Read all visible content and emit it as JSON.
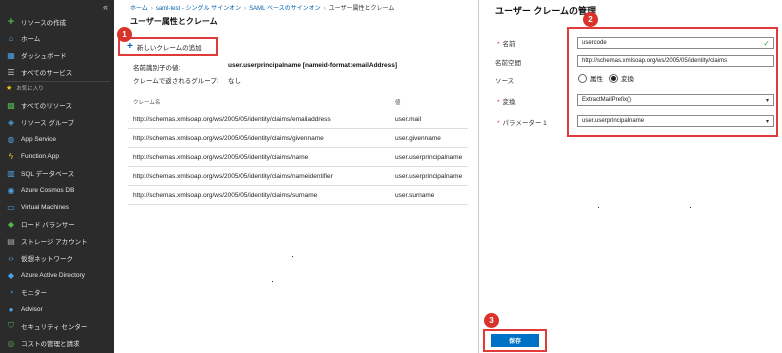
{
  "sidebar": {
    "collapse_icon": "double-chevron-left-icon",
    "items": [
      {
        "label": "リソースの作成",
        "icon": "plus-icon",
        "color": "#4fb34f"
      },
      {
        "label": "ホーム",
        "icon": "home-icon",
        "color": "#4aa3e8"
      },
      {
        "label": "ダッシュボード",
        "icon": "dashboard-icon",
        "color": "#4aa3e8"
      },
      {
        "label": "すべてのサービス",
        "icon": "list-icon",
        "color": "#cccccc"
      },
      {
        "label": "すべてのリソース",
        "icon": "grid-icon",
        "color": "#4fb34f"
      },
      {
        "label": "リソース グループ",
        "icon": "cube-icon",
        "color": "#4aa3e8"
      },
      {
        "label": "App Service",
        "icon": "globe-icon",
        "color": "#4aa3e8"
      },
      {
        "label": "Function App",
        "icon": "lightning-icon",
        "color": "#f2c811"
      },
      {
        "label": "SQL データベース",
        "icon": "database-icon",
        "color": "#4aa3e8"
      },
      {
        "label": "Azure Cosmos DB",
        "icon": "planet-icon",
        "color": "#4aa3e8"
      },
      {
        "label": "Virtual Machines",
        "icon": "monitor-icon",
        "color": "#4aa3e8"
      },
      {
        "label": "ロード バランサー",
        "icon": "diamond-icon",
        "color": "#4fb34f"
      },
      {
        "label": "ストレージ アカウント",
        "icon": "storage-icon",
        "color": "#aaaaaa"
      },
      {
        "label": "仮想ネットワーク",
        "icon": "network-icon",
        "color": "#4aa3e8"
      },
      {
        "label": "Azure Active Directory",
        "icon": "aad-icon",
        "color": "#4aa3e8"
      },
      {
        "label": "モニター",
        "icon": "gauge-icon",
        "color": "#4aa3e8"
      },
      {
        "label": "Advisor",
        "icon": "advisor-icon",
        "color": "#4aa3e8"
      },
      {
        "label": "セキュリティ センター",
        "icon": "shield-icon",
        "color": "#4fb34f"
      },
      {
        "label": "コストの管理と請求",
        "icon": "cost-icon",
        "color": "#4fb34f"
      }
    ],
    "favorites_label": "お気に入り"
  },
  "breadcrumb": {
    "items": [
      "ホーム",
      "saml-test - シングル サインオン",
      "SAML ベースのサインオン",
      "ユーザー属性とクレーム"
    ]
  },
  "page_title": "ユーザー属性とクレーム",
  "add_claim_label": "新しいクレームの追加",
  "markers": [
    "1",
    "2",
    "3"
  ],
  "meta": {
    "name_id_label": "名前識別子の値:",
    "name_id_value": "user.userprincipalname [nameid-format:emailAddress]",
    "groups_label": "クレームで返されるグループ:",
    "groups_value": "なし"
  },
  "table": {
    "headers": [
      "クレーム名",
      "値"
    ],
    "rows": [
      [
        "http://schemas.xmlsoap.org/ws/2005/05/identity/claims/emailaddress",
        "user.mail"
      ],
      [
        "http://schemas.xmlsoap.org/ws/2005/05/identity/claims/givenname",
        "user.givenname"
      ],
      [
        "http://schemas.xmlsoap.org/ws/2005/05/identity/claims/name",
        "user.userprincipalname"
      ],
      [
        "http://schemas.xmlsoap.org/ws/2005/05/identity/claims/nameidentifier",
        "user.userprincipalname"
      ],
      [
        "http://schemas.xmlsoap.org/ws/2005/05/identity/claims/surname",
        "user.surname"
      ]
    ]
  },
  "panel": {
    "title": "ユーザー クレームの管理",
    "name_label": "名前",
    "name_value": "usercode",
    "namespace_label": "名前空間",
    "namespace_value": "http://schemas.xmlsoap.org/ws/2005/05/identity/claims",
    "source_label": "ソース",
    "source_options": [
      "属性",
      "変換"
    ],
    "source_selected": "変換",
    "transform_label": "変換",
    "transform_value": "ExtractMailPrefix()",
    "param_label": "パラメーター 1",
    "param_value": "user.userprincipalname",
    "save_label": "保存"
  },
  "colors": {
    "accent": "#0072c6",
    "highlight": "#e03a3a",
    "sidebar_bg": "#2b2b2b"
  }
}
